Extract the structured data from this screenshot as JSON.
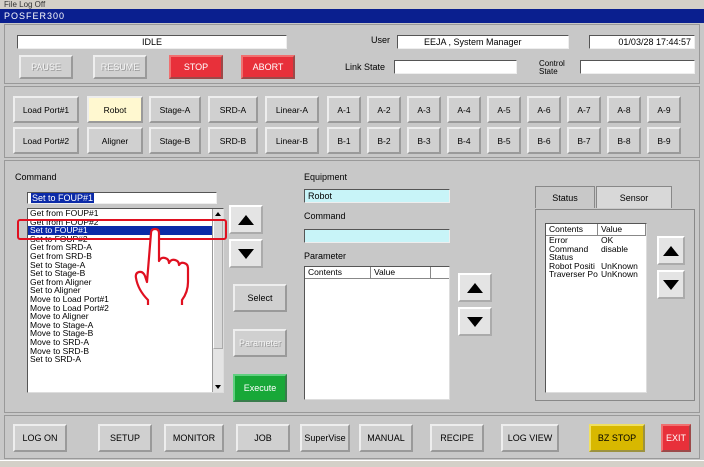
{
  "menu": {
    "items": "File   Log Off"
  },
  "window": {
    "title": "POSFER300"
  },
  "status": {
    "state": "IDLE",
    "user_label": "User",
    "user_value": "EEJA , System Manager",
    "datetime": "01/03/28 17:44:57",
    "link_state_label": "Link State",
    "link_state_value": "",
    "control_state_label": "Control State",
    "control_state_value": ""
  },
  "controls": {
    "pause": "PAUSE",
    "resume": "RESUME",
    "stop": "STOP",
    "abort": "ABORT"
  },
  "row1": [
    "Load Port#1",
    "Robot",
    "Stage-A",
    "SRD-A",
    "Linear-A",
    "A-1",
    "A-2",
    "A-3",
    "A-4",
    "A-5",
    "A-6",
    "A-7",
    "A-8",
    "A-9"
  ],
  "row2": [
    "Load Port#2",
    "Aligner",
    "Stage-B",
    "SRD-B",
    "Linear-B",
    "B-1",
    "B-2",
    "B-3",
    "B-4",
    "B-5",
    "B-6",
    "B-7",
    "B-8",
    "B-9"
  ],
  "selected_tab": "Robot",
  "command": {
    "label": "Command",
    "current": "Set to FOUP#1",
    "list": [
      "Get from FOUP#1",
      "Get from FOUP#2",
      "Set to FOUP#1",
      "Set to FOUP#2",
      "Get from SRD-A",
      "Get from SRD-B",
      "Set to Stage-A",
      "Set to Stage-B",
      "Get from Aligner",
      "Set to Aligner",
      "Move to Load Port#1",
      "Move to Load Port#2",
      "Move to Aligner",
      "Move to Stage-A",
      "Move to Stage-B",
      "Move to SRD-A",
      "Move to SRD-B",
      "Set to SRD-A"
    ],
    "selected_index": 2
  },
  "actions": {
    "select": "Select",
    "parameter": "Parameter",
    "execute": "Execute"
  },
  "equipment": {
    "label": "Equipment",
    "value": "Robot",
    "command_label": "Command",
    "command_value": "",
    "parameter_label": "Parameter",
    "param_headers": [
      "Contents",
      "Value"
    ]
  },
  "status_panel": {
    "tabs": [
      "Status",
      "Sensor"
    ],
    "headers": [
      "Contents",
      "Value"
    ],
    "rows": [
      {
        "c": "Error",
        "v": "OK"
      },
      {
        "c": "Command",
        "v": "disable"
      },
      {
        "c": "Status",
        "v": ""
      },
      {
        "c": "Robot Positi",
        "v": "UnKnown"
      },
      {
        "c": "Traverser Po",
        "v": "UnKnown"
      }
    ]
  },
  "bottom": [
    "LOG ON",
    "SETUP",
    "MONITOR",
    "JOB",
    "SuperVise",
    "MANUAL",
    "RECIPE",
    "LOG VIEW",
    "BZ STOP",
    "EXIT"
  ],
  "colors": {
    "title": "#0a1f8f",
    "stop": "#e8303a",
    "execute": "#18a838",
    "bzstop": "#d8b800",
    "highlight": "#e01020"
  }
}
